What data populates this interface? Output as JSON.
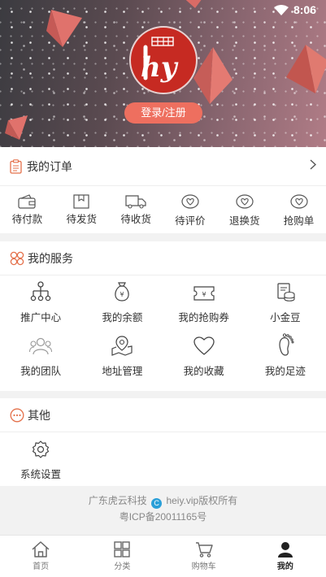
{
  "status_bar": {
    "time": "8:06"
  },
  "header": {
    "login_label": "登录/注册",
    "logo_text": "hy"
  },
  "orders": {
    "title": "我的订单",
    "items": [
      {
        "label": "待付款",
        "icon": "wallet-icon"
      },
      {
        "label": "待发货",
        "icon": "box-icon"
      },
      {
        "label": "待收货",
        "icon": "truck-icon"
      },
      {
        "label": "待评价",
        "icon": "heart-chat-icon"
      },
      {
        "label": "退换货",
        "icon": "heart-chat-icon"
      },
      {
        "label": "抢购单",
        "icon": "heart-chat-icon"
      }
    ]
  },
  "services": {
    "title": "我的服务",
    "items": [
      {
        "label": "推广中心",
        "icon": "network-icon"
      },
      {
        "label": "我的余额",
        "icon": "money-bag-icon"
      },
      {
        "label": "我的抢购券",
        "icon": "ticket-icon"
      },
      {
        "label": "小金豆",
        "icon": "coins-icon"
      },
      {
        "label": "我的团队",
        "icon": "team-icon"
      },
      {
        "label": "地址管理",
        "icon": "location-icon"
      },
      {
        "label": "我的收藏",
        "icon": "heart-icon"
      },
      {
        "label": "我的足迹",
        "icon": "footprint-icon"
      }
    ]
  },
  "others": {
    "title": "其他",
    "items": [
      {
        "label": "系统设置",
        "icon": "settings-icon"
      }
    ]
  },
  "footer": {
    "company": "广东虎云科技",
    "copyright_mark": "C",
    "rights": "heiy.vip版权所有",
    "icp": "粤ICP备20011165号"
  },
  "tabbar": [
    {
      "label": "首页",
      "icon": "home-icon"
    },
    {
      "label": "分类",
      "icon": "category-icon"
    },
    {
      "label": "购物车",
      "icon": "cart-icon"
    },
    {
      "label": "我的",
      "icon": "user-icon",
      "active": true
    }
  ],
  "colors": {
    "accent": "#ee6f5f",
    "logo_red": "#c62a22"
  }
}
